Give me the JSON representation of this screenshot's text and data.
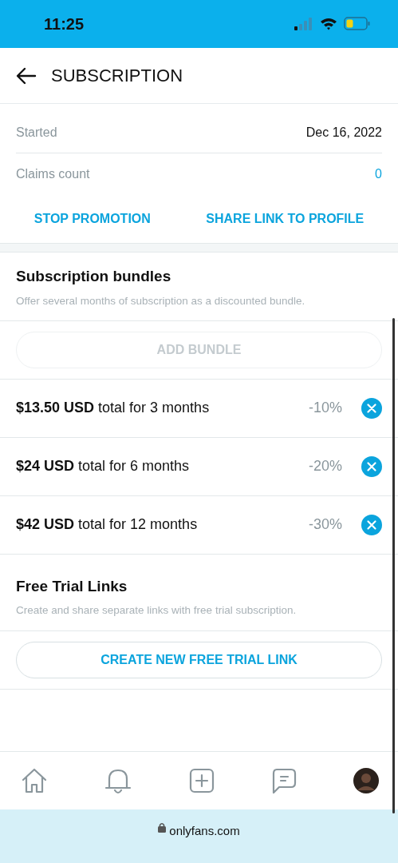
{
  "status_bar": {
    "time": "11:25"
  },
  "header": {
    "title": "SUBSCRIPTION"
  },
  "details": [
    {
      "label": "Started",
      "value": "Dec 16, 2022",
      "kind": "plain"
    },
    {
      "label": "Claims count",
      "value": "0",
      "kind": "link"
    }
  ],
  "actions": [
    "STOP PROMOTION",
    "SHARE LINK TO PROFILE"
  ],
  "bundles_section": {
    "title": "Subscription bundles",
    "description": "Offer several months of subscription as a discounted bundle.",
    "button": {
      "label": "ADD BUNDLE",
      "disabled": true
    },
    "bundles": [
      {
        "text": "**$13.50 USD** total for 3 months",
        "discount": "-10%"
      },
      {
        "text": "**$24 USD** total for 6 months",
        "discount": "-20%"
      },
      {
        "text": "**$42 USD** total for 12 months",
        "discount": "-30%"
      }
    ]
  },
  "trial_section": {
    "title": "Free Trial Links",
    "description": "Create and share separate links with free trial subscription.",
    "button": {
      "label": "CREATE NEW FREE TRIAL LINK",
      "disabled": false
    }
  },
  "tab_bar": [
    {
      "kind": "home"
    },
    {
      "kind": "bell"
    },
    {
      "kind": "add"
    },
    {
      "kind": "chat"
    },
    {
      "kind": "avatar"
    }
  ],
  "browser": {
    "url": "onlyfans.com"
  }
}
